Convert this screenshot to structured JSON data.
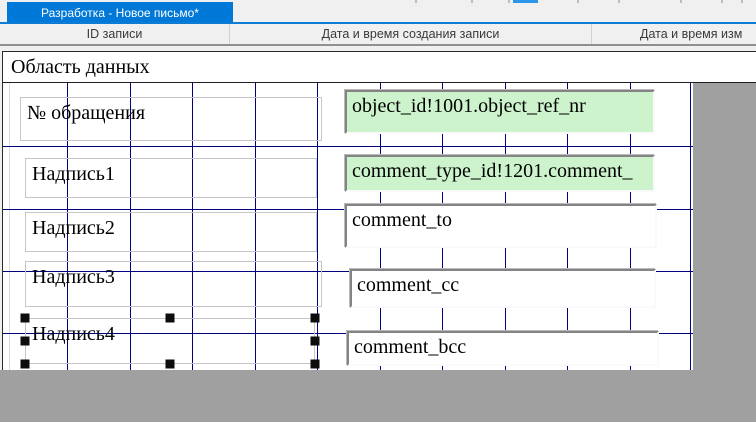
{
  "window": {
    "tab_title": "Разработка - Новое письмо*"
  },
  "grid_columns": {
    "col1": "ID записи",
    "col2": "Дата и время создания записи",
    "col3": "Дата и время изм"
  },
  "band": {
    "title": "Область данных"
  },
  "designer": {
    "labels": [
      {
        "text": "№ обращения"
      },
      {
        "text": "Надпись1"
      },
      {
        "text": "Надпись2"
      },
      {
        "text": "Надпись3"
      },
      {
        "text": "Надпись4",
        "selected": "true"
      }
    ],
    "fields": [
      {
        "text": "object_id!1001.object_ref_nr",
        "bg": "#ccf3cc"
      },
      {
        "text": "comment_type_id!1201.comment_",
        "bg": "#ccf3cc"
      },
      {
        "text": "comment_to",
        "bg": "#ffffff"
      },
      {
        "text": "comment_cc",
        "bg": "#ffffff"
      },
      {
        "text": "comment_bcc",
        "bg": "#ffffff"
      }
    ]
  },
  "colors": {
    "tab_blue": "#0078d7",
    "grid_navy": "#000080",
    "field_green": "#ccf3cc",
    "outside_gray": "#a0a0a0"
  }
}
